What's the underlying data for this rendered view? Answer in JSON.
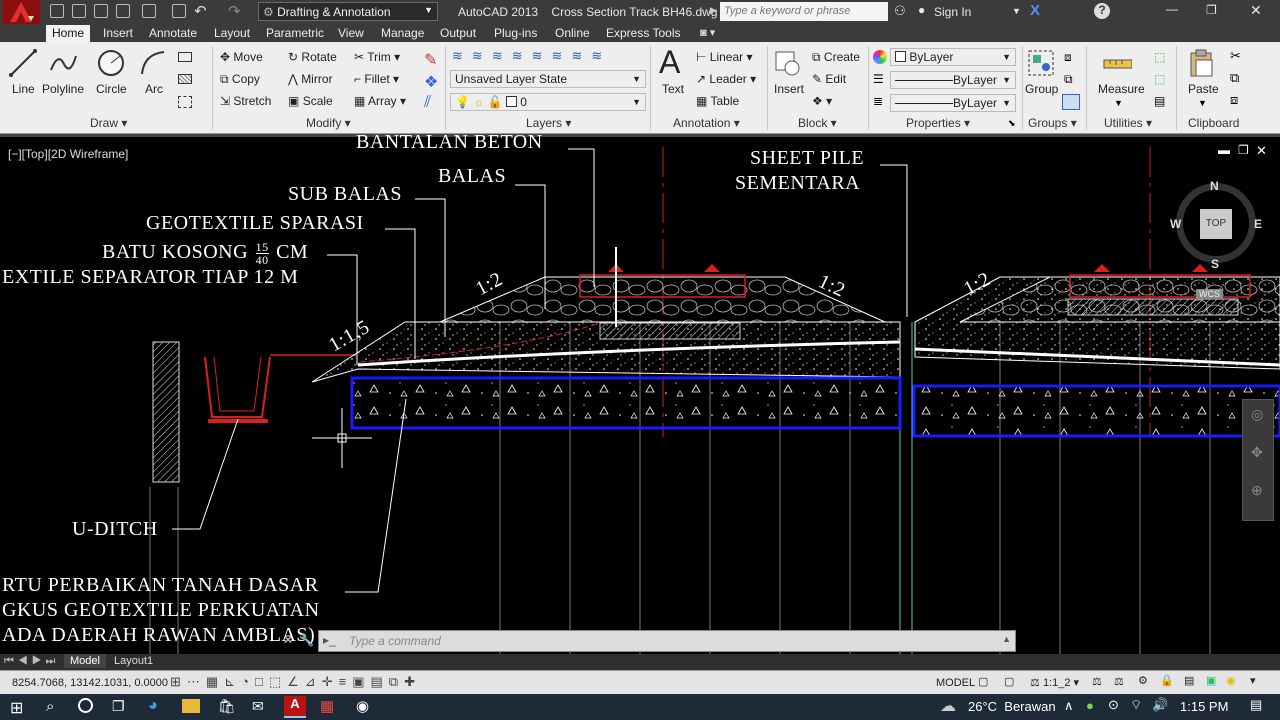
{
  "window": {
    "app_title": "AutoCAD 2013",
    "file_name": "Cross Section Track BH46.dwg",
    "workspace": "Drafting & Annotation",
    "search_placeholder": "Type a keyword or phrase",
    "sign_in": "Sign In"
  },
  "tabs": [
    "Home",
    "Insert",
    "Annotate",
    "Layout",
    "Parametric",
    "View",
    "Manage",
    "Output",
    "Plug-ins",
    "Online",
    "Express Tools"
  ],
  "ribbon": {
    "draw": {
      "title": "Draw",
      "line": "Line",
      "polyline": "Polyline",
      "circle": "Circle",
      "arc": "Arc"
    },
    "modify": {
      "title": "Modify",
      "move": "Move",
      "rotate": "Rotate",
      "trim": "Trim",
      "copy": "Copy",
      "mirror": "Mirror",
      "fillet": "Fillet",
      "stretch": "Stretch",
      "scale": "Scale",
      "array": "Array"
    },
    "layers": {
      "title": "Layers",
      "layer_state": "Unsaved Layer State",
      "current_layer": "0"
    },
    "annotation": {
      "title": "Annotation",
      "text": "Text",
      "linear": "Linear",
      "leader": "Leader",
      "table": "Table"
    },
    "block": {
      "title": "Block",
      "insert": "Insert",
      "create": "Create",
      "edit": "Edit"
    },
    "properties": {
      "title": "Properties",
      "color": "ByLayer",
      "linetype": "ByLayer",
      "lineweight": "ByLayer"
    },
    "groups": {
      "title": "Groups",
      "group": "Group"
    },
    "utilities": {
      "title": "Utilities",
      "measure": "Measure"
    },
    "clipboard": {
      "title": "Clipboard",
      "paste": "Paste"
    }
  },
  "viewport": {
    "label": "[−][Top][2D Wireframe]",
    "viewcube": {
      "n": "N",
      "s": "S",
      "e": "E",
      "w": "W",
      "top": "TOP",
      "wcs": "WCS"
    }
  },
  "drawing_text": {
    "bantalan": "BANTALAN BETON",
    "balas": "BALAS",
    "sub_balas": "SUB BALAS",
    "geotextile": "GEOTEXTILE SPARASI",
    "batu_kosong": "BATU KOSONG",
    "frac_num": "15",
    "frac_den": "40",
    "cm": "CM",
    "separator": "EXTILE SEPARATOR TIAP 12 M",
    "sheet_pile_1": "SHEET PILE",
    "sheet_pile_2": "SEMENTARA",
    "u_ditch": "U-DITCH",
    "slope_1": "1:1,5",
    "slope_2": "1:2",
    "slope_3": "1:2",
    "slope_4": "1:2",
    "bottom_1": "RTU PERBAIKAN TANAH DASAR",
    "bottom_2": "GKUS GEOTEXTILE PERKUATAN",
    "bottom_3": "ADA DAERAH RAWAN AMBLAS)"
  },
  "command": {
    "placeholder": "Type a command"
  },
  "layout_tabs": [
    "Model",
    "Layout1"
  ],
  "status": {
    "coords": "8254.7068, 13142.1031, 0.0000",
    "model": "MODEL",
    "scale": "1:1_2"
  },
  "taskbar": {
    "weather_temp": "26°C",
    "weather_desc": "Berawan",
    "time": "1:15 PM"
  },
  "colors": {
    "accent_red": "#d82020",
    "blue_box": "#1a1aff",
    "ribbon_bg": "#eeeeee",
    "title_bg": "#3b3b3b"
  }
}
